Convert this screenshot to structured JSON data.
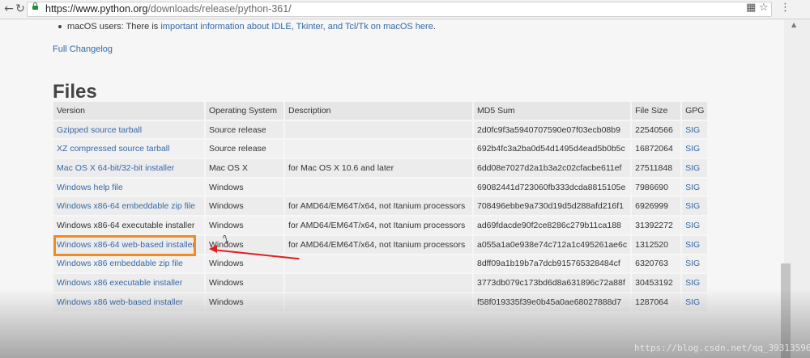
{
  "browser": {
    "url_scheme_host": "https://www.python.org",
    "url_path": "/downloads/release/python-361/",
    "icons": [
      "back-icon",
      "refresh-icon",
      "lock-icon",
      "translate-icon",
      "star-icon",
      "menu-icon"
    ]
  },
  "page": {
    "bullet_prefix": "macOS users: There is ",
    "bullet_link": "important information about IDLE, Tkinter, and Tcl/Tk on macOS here",
    "bullet_suffix": ".",
    "changelog_link": "Full Changelog",
    "files_heading": "Files"
  },
  "table": {
    "headers": [
      "Version",
      "Operating System",
      "Description",
      "MD5 Sum",
      "File Size",
      "GPG"
    ],
    "rows": [
      {
        "version": "Gzipped source tarball",
        "os": "Source release",
        "desc": "",
        "md5": "2d0fc9f3a5940707590e07f03ecb08b9",
        "size": "22540566",
        "gpg": "SIG"
      },
      {
        "version": "XZ compressed source tarball",
        "os": "Source release",
        "desc": "",
        "md5": "692b4fc3a2ba0d54d1495d4ead5b0b5c",
        "size": "16872064",
        "gpg": "SIG"
      },
      {
        "version": "Mac OS X 64-bit/32-bit installer",
        "os": "Mac OS X",
        "desc": "for Mac OS X 10.6 and later",
        "md5": "6dd08e7027d2a1b3a2c02cfacbe611ef",
        "size": "27511848",
        "gpg": "SIG"
      },
      {
        "version": "Windows help file",
        "os": "Windows",
        "desc": "",
        "md5": "69082441d723060fb333dcda8815105e",
        "size": "7986690",
        "gpg": "SIG"
      },
      {
        "version": "Windows x86-64 embeddable zip file",
        "os": "Windows",
        "desc": "for AMD64/EM64T/x64, not Itanium processors",
        "md5": "708496ebbe9a730d19d5d288afd216f1",
        "size": "6926999",
        "gpg": "SIG"
      },
      {
        "version": "Windows x86-64 executable installer",
        "os": "Windows",
        "desc": "for AMD64/EM64T/x64, not Itanium processors",
        "md5": "ad69fdacde90f2ce8286c279b11ca188",
        "size": "31392272",
        "gpg": "SIG"
      },
      {
        "version": "Windows x86-64 web-based installer",
        "os": "Windows",
        "desc": "for AMD64/EM64T/x64, not Itanium processors",
        "md5": "a055a1a0e938e74c712a1c495261ae6c",
        "size": "1312520",
        "gpg": "SIG"
      },
      {
        "version": "Windows x86 embeddable zip file",
        "os": "Windows",
        "desc": "",
        "md5": "8dff09a1b19b7a7dcb915765328484cf",
        "size": "6320763",
        "gpg": "SIG"
      },
      {
        "version": "Windows x86 executable installer",
        "os": "Windows",
        "desc": "",
        "md5": "3773db079c173bd6d8a631896c72a88f",
        "size": "30453192",
        "gpg": "SIG"
      },
      {
        "version": "Windows x86 web-based installer",
        "os": "Windows",
        "desc": "",
        "md5": "f58f019335f39e0b45a0ae68027888d7",
        "size": "1287064",
        "gpg": "SIG"
      }
    ]
  },
  "annotation": {
    "highlight_color": "#f08a24",
    "arrow_color": "#e02020"
  },
  "watermark": "https://blog.csdn.net/qq_39313596"
}
